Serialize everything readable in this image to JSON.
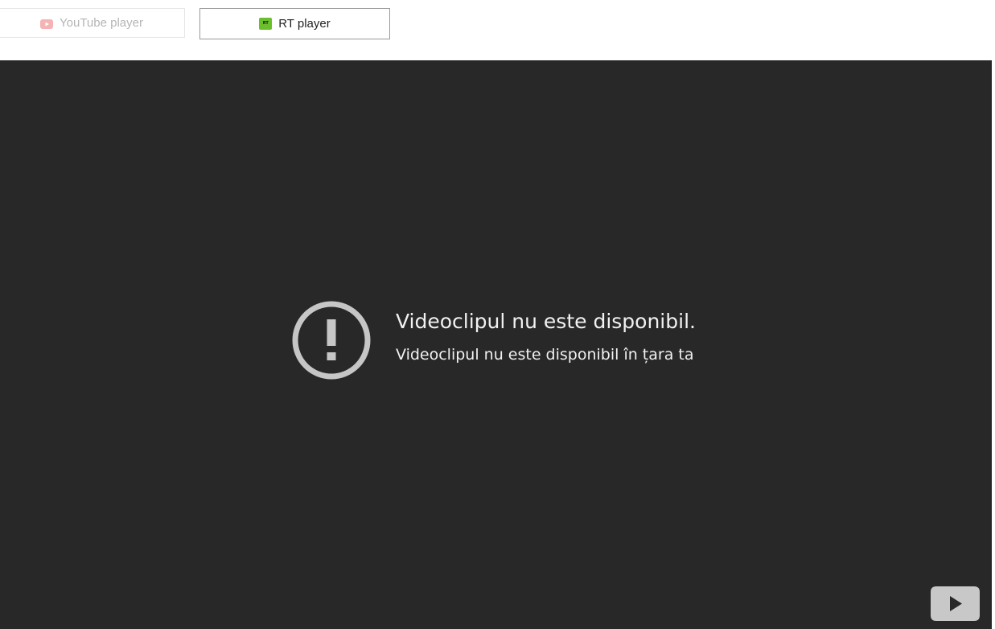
{
  "tabs": {
    "youtube": {
      "label": "YouTube player",
      "icon": "youtube-icon",
      "color": "#b5b5b5",
      "icon_color": "#f6b3b3"
    },
    "rt": {
      "label": "RT player",
      "icon": "rt-logo-icon",
      "logo_text": "RT",
      "color": "#222222",
      "logo_color": "#6abf2b"
    }
  },
  "player": {
    "background": "#282828",
    "error_icon": "alert-circle-icon",
    "error_title": "Videoclipul nu este disponibil.",
    "error_subtitle": "Videoclipul nu este disponibil în țara ta",
    "watch_button_icon": "youtube-logo-icon"
  }
}
